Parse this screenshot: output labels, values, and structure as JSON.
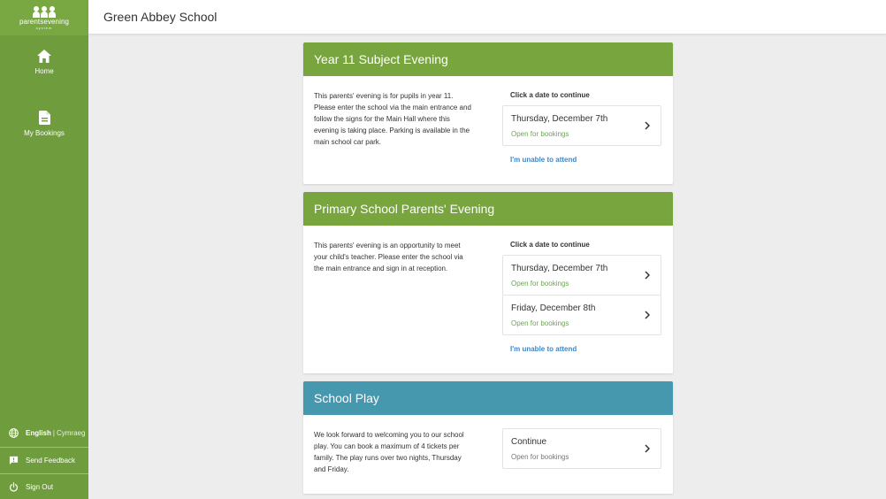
{
  "sidebar": {
    "logo_text": "parentsevening",
    "logo_sub": "system",
    "items": [
      {
        "label": "Home",
        "icon": "home-icon"
      },
      {
        "label": "My Bookings",
        "icon": "document-icon"
      }
    ],
    "footer": {
      "language_current": "English",
      "language_separator": "|",
      "language_alt": "Cymraeg",
      "feedback_label": "Send Feedback",
      "signout_label": "Sign Out"
    }
  },
  "header": {
    "school_name": "Green Abbey School"
  },
  "events": [
    {
      "title": "Year 11 Subject Evening",
      "color": "#78a53e",
      "description": "This parents' evening is for pupils in year 11. Please enter the school via the main entrance and follow the signs for the Main Hall where this evening is taking place. Parking is available in the main school car park.",
      "prompt": "Click a date to continue",
      "dates": [
        {
          "label": "Thursday, December 7th",
          "status": "Open for bookings"
        }
      ],
      "unable_label": "I'm unable to attend"
    },
    {
      "title": "Primary School Parents' Evening",
      "color": "#78a53e",
      "description": "This parents' evening is an opportunity to meet your child's teacher. Please enter the school via the main entrance and sign in at reception.",
      "prompt": "Click a date to continue",
      "dates": [
        {
          "label": "Thursday, December 7th",
          "status": "Open for bookings"
        },
        {
          "label": "Friday, December 8th",
          "status": "Open for bookings"
        }
      ],
      "unable_label": "I'm unable to attend"
    },
    {
      "title": "School Play",
      "color": "#4598ad",
      "description": "We look forward to welcoming you to our school play. You can book a maximum of 4 tickets per family. The play runs over two nights, Thursday and Friday.",
      "action": {
        "label": "Continue",
        "status": "Open for bookings"
      }
    }
  ]
}
